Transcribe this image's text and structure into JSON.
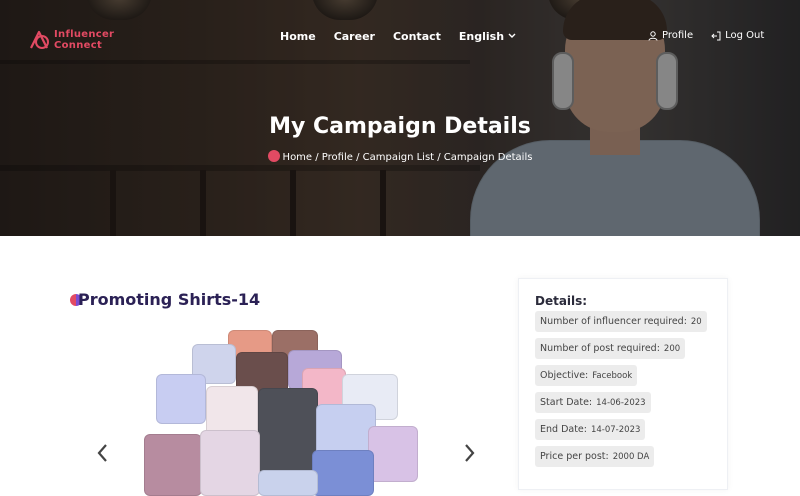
{
  "brand": {
    "line1": "Influencer",
    "line2": "Connect"
  },
  "nav": {
    "home": "Home",
    "career": "Career",
    "contact": "Contact",
    "language": "English"
  },
  "account": {
    "profile": "Profile",
    "logout": "Log Out"
  },
  "hero": {
    "title": "My Campaign Details",
    "breadcrumb": "Home / Profile / Campaign List / Campaign Details"
  },
  "campaign": {
    "title": "Promoting Shirts-14"
  },
  "details": {
    "heading": "Details:",
    "items": [
      {
        "label": "Number of influencer required:",
        "value": "20"
      },
      {
        "label": "Number of post required:",
        "value": "200"
      },
      {
        "label": "Objective:",
        "value": "Facebook"
      },
      {
        "label": "Start Date:",
        "value": "14-06-2023"
      },
      {
        "label": "End Date:",
        "value": "14-07-2023"
      },
      {
        "label": "Price per post:",
        "value": "2000 DA"
      }
    ]
  },
  "colors": {
    "brand": "#e24a63",
    "title": "#2b2155",
    "chip_bg": "#ececec"
  },
  "icons": [
    "brand-logo-icon",
    "chevron-down-icon",
    "user-icon",
    "logout-icon",
    "breadcrumb-home-icon",
    "chevron-left-icon",
    "chevron-right-icon"
  ]
}
